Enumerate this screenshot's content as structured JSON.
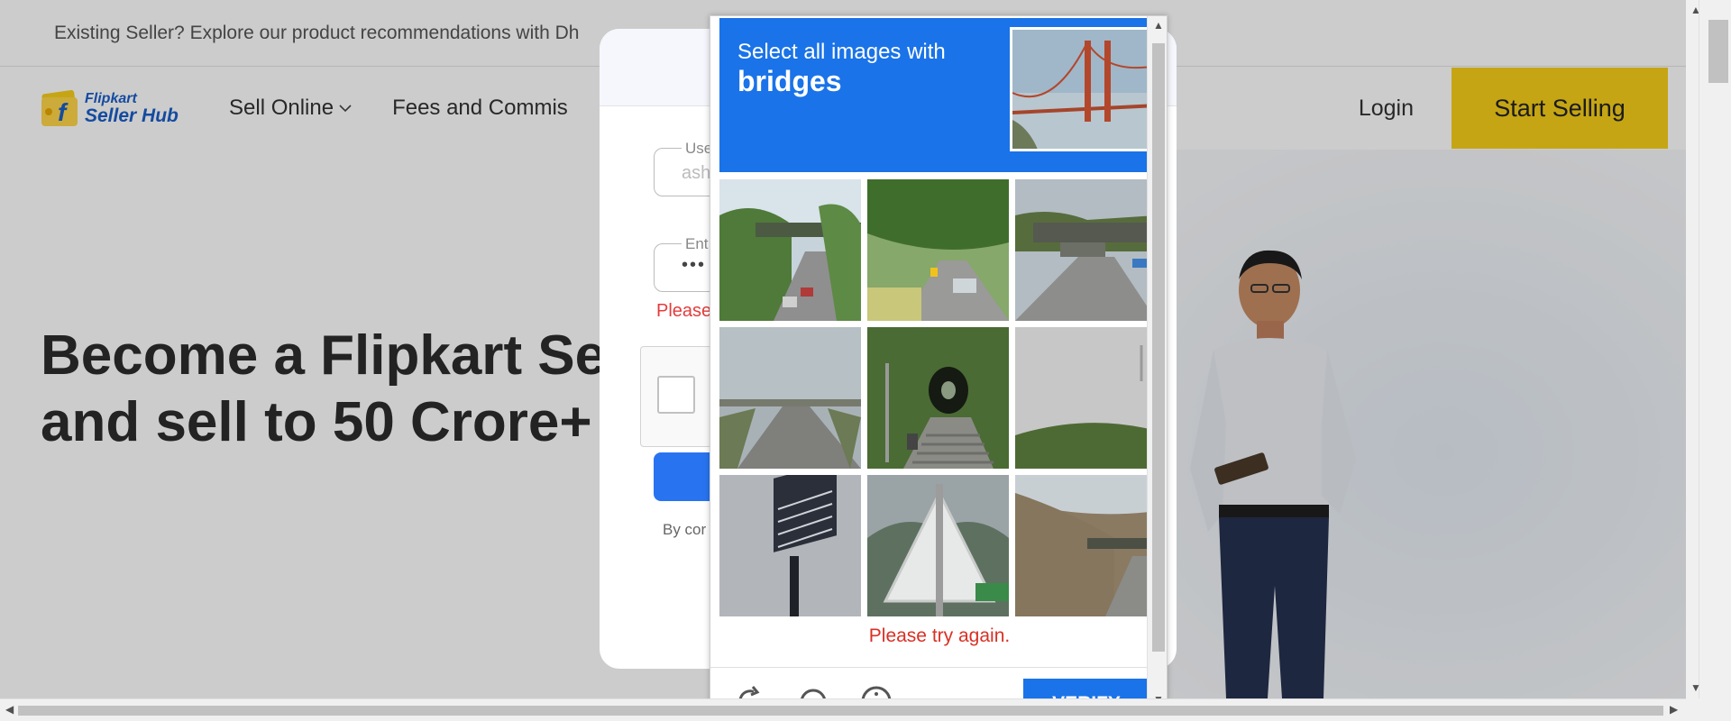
{
  "banner": {
    "text": "Existing Seller? Explore our product recommendations with Dh"
  },
  "header": {
    "logo_line1": "Flipkart",
    "logo_line2": "Seller Hub",
    "nav": [
      {
        "label": "Sell Online"
      },
      {
        "label": "Fees and Commis"
      }
    ],
    "login": "Login",
    "start_selling": "Start Selling"
  },
  "hero": {
    "line1": "Become a Flipkart Sel",
    "line2": "and sell to 50 Crore+"
  },
  "login_modal": {
    "username_label": "Use",
    "username_value": "ash",
    "password_label": "Ent",
    "password_value": "•••",
    "error_text": "Please",
    "consent_text": "By cor"
  },
  "captcha": {
    "instruction": "Select all images with",
    "keyword": "bridges",
    "error": "Please try again.",
    "verify_label": "VERIFY",
    "colors": {
      "header": "#1a73e8",
      "error": "#d93025"
    }
  },
  "colors": {
    "brand_blue": "#2874f0",
    "start_selling": "#f7cf19"
  }
}
